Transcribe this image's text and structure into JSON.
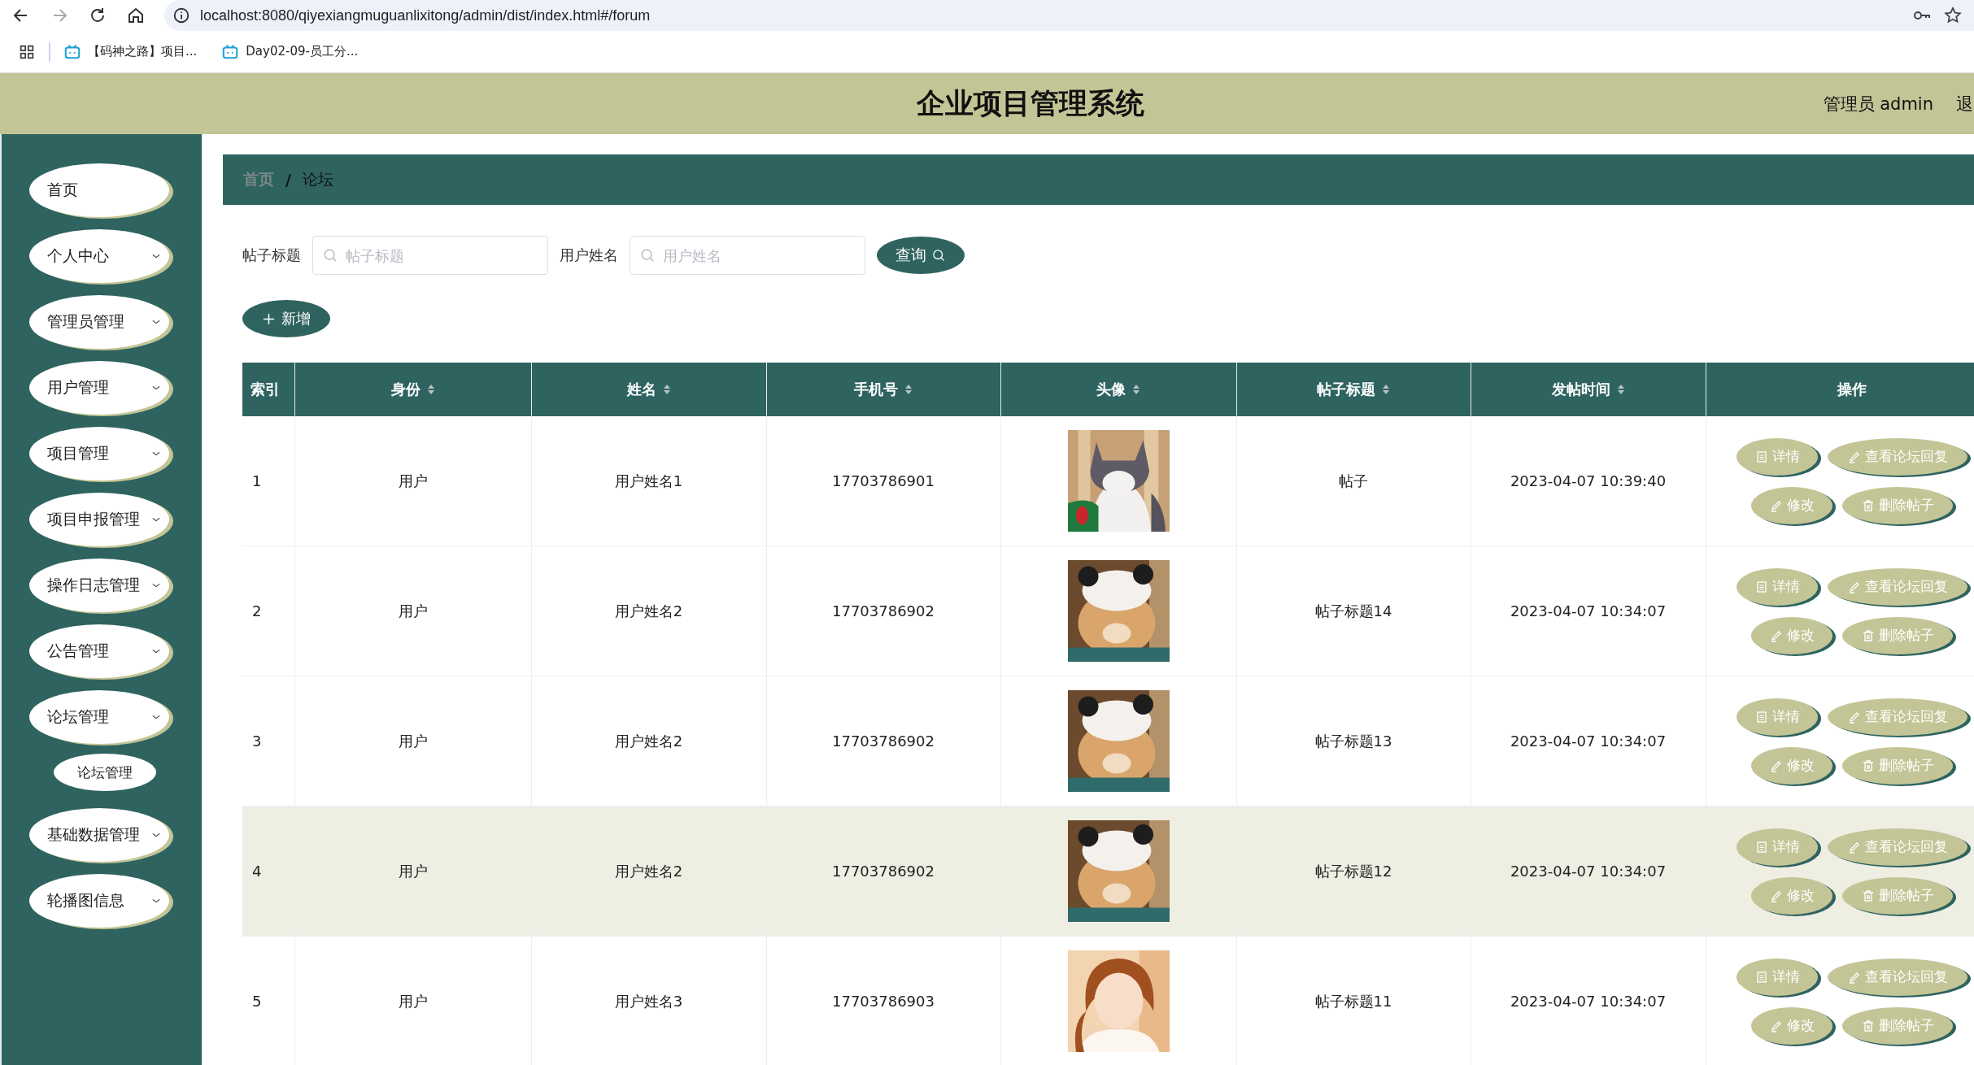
{
  "browser": {
    "nav": [
      {
        "kind": "back",
        "disabled": false
      },
      {
        "kind": "forward",
        "disabled": true
      },
      {
        "kind": "reload",
        "disabled": false
      },
      {
        "kind": "home",
        "disabled": false
      }
    ],
    "url": "localhost:8080/qiyexiangmuguanlixitong/admin/dist/index.html#/forum",
    "bookmarks": [
      {
        "label": "【码神之路】项目..."
      },
      {
        "label": "Day02-09-员工分..."
      }
    ]
  },
  "header": {
    "title": "企业项目管理系统",
    "user": "管理员 admin",
    "logout": "退"
  },
  "sidebar": {
    "items": [
      {
        "label": "首页",
        "has_submenu": false
      },
      {
        "label": "个人中心",
        "has_submenu": true
      },
      {
        "label": "管理员管理",
        "has_submenu": true
      },
      {
        "label": "用户管理",
        "has_submenu": true
      },
      {
        "label": "项目管理",
        "has_submenu": true
      },
      {
        "label": "项目申报管理",
        "has_submenu": true
      },
      {
        "label": "操作日志管理",
        "has_submenu": true
      },
      {
        "label": "公告管理",
        "has_submenu": true
      },
      {
        "label": "论坛管理",
        "has_submenu": true,
        "children": [
          {
            "label": "论坛管理"
          }
        ]
      },
      {
        "label": "基础数据管理",
        "has_submenu": true
      },
      {
        "label": "轮播图信息",
        "has_submenu": true
      }
    ]
  },
  "breadcrumb": {
    "separator": "/",
    "items": [
      {
        "label": "首页",
        "current": false
      },
      {
        "label": "论坛",
        "current": true
      }
    ]
  },
  "search": {
    "fields": [
      {
        "label": "帖子标题",
        "placeholder": "帖子标题"
      },
      {
        "label": "用户姓名",
        "placeholder": "用户姓名"
      }
    ],
    "query_button": "查询",
    "add_button": "新增"
  },
  "table": {
    "columns": [
      {
        "label": "索引",
        "sortable": false
      },
      {
        "label": "身份",
        "sortable": true
      },
      {
        "label": "姓名",
        "sortable": true
      },
      {
        "label": "手机号",
        "sortable": true
      },
      {
        "label": "头像",
        "sortable": true
      },
      {
        "label": "帖子标题",
        "sortable": true
      },
      {
        "label": "发帖时间",
        "sortable": true
      },
      {
        "label": "操作",
        "sortable": false
      }
    ],
    "rows": [
      {
        "index": "1",
        "role": "用户",
        "name": "用户姓名1",
        "phone": "17703786901",
        "avatar": {
          "kind": "picture"
        },
        "title": "帖子",
        "time": "2023-04-07 10:39:40",
        "hovered": false,
        "actions": [
          {
            "kind": "detail",
            "label": "详情"
          },
          {
            "kind": "edit",
            "label": "查看论坛回复"
          },
          {
            "kind": "edit",
            "label": "修改"
          },
          {
            "kind": "delete",
            "label": "删除帖子"
          }
        ]
      },
      {
        "index": "2",
        "role": "用户",
        "name": "用户姓名2",
        "phone": "17703786902",
        "avatar": {
          "kind": "picture"
        },
        "title": "帖子标题14",
        "time": "2023-04-07 10:34:07",
        "hovered": false,
        "actions": [
          {
            "kind": "detail",
            "label": "详情"
          },
          {
            "kind": "edit",
            "label": "查看论坛回复"
          },
          {
            "kind": "edit",
            "label": "修改"
          },
          {
            "kind": "delete",
            "label": "删除帖子"
          }
        ]
      },
      {
        "index": "3",
        "role": "用户",
        "name": "用户姓名2",
        "phone": "17703786902",
        "avatar": {
          "kind": "picture"
        },
        "title": "帖子标题13",
        "time": "2023-04-07 10:34:07",
        "hovered": false,
        "actions": [
          {
            "kind": "detail",
            "label": "详情"
          },
          {
            "kind": "edit",
            "label": "查看论坛回复"
          },
          {
            "kind": "edit",
            "label": "修改"
          },
          {
            "kind": "delete",
            "label": "删除帖子"
          }
        ]
      },
      {
        "index": "4",
        "role": "用户",
        "name": "用户姓名2",
        "phone": "17703786902",
        "avatar": {
          "kind": "picture"
        },
        "title": "帖子标题12",
        "time": "2023-04-07 10:34:07",
        "hovered": true,
        "actions": [
          {
            "kind": "detail",
            "label": "详情"
          },
          {
            "kind": "edit",
            "label": "查看论坛回复"
          },
          {
            "kind": "edit",
            "label": "修改"
          },
          {
            "kind": "delete",
            "label": "删除帖子"
          }
        ]
      },
      {
        "index": "5",
        "role": "用户",
        "name": "用户姓名3",
        "phone": "17703786903",
        "avatar": {
          "kind": "picture"
        },
        "title": "帖子标题11",
        "time": "2023-04-07 10:34:07",
        "hovered": false,
        "actions": [
          {
            "kind": "detail",
            "label": "详情"
          },
          {
            "kind": "edit",
            "label": "查看论坛回复"
          },
          {
            "kind": "edit",
            "label": "修改"
          },
          {
            "kind": "delete",
            "label": "删除帖子"
          }
        ]
      }
    ]
  }
}
